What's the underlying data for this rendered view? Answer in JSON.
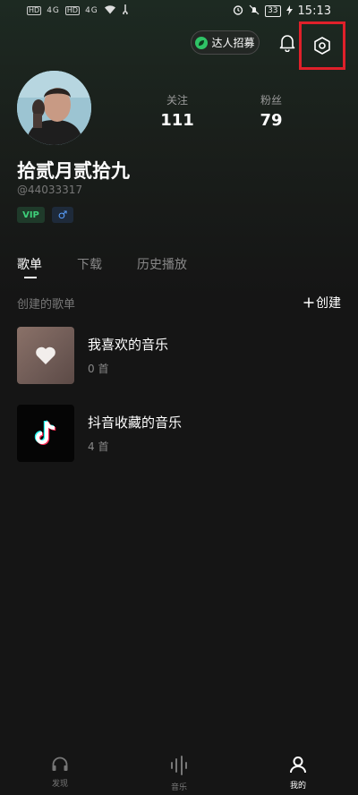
{
  "status_bar": {
    "hd1": "HD",
    "hd2": "HD",
    "sig1": "4G",
    "sig2": "4G",
    "battery": "33",
    "time": "15:13"
  },
  "header": {
    "recruit_label": "达人招募"
  },
  "profile": {
    "username": "拾贰月贰拾九",
    "user_id": "@44033317",
    "vip_badge": "VIP",
    "gender_symbol": "♂",
    "stats": {
      "follow_label": "关注",
      "follow_count": "111",
      "fans_label": "粉丝",
      "fans_count": "79"
    }
  },
  "tabs": [
    {
      "label": "歌单"
    },
    {
      "label": "下载"
    },
    {
      "label": "历史播放"
    }
  ],
  "playlists_section": {
    "title": "创建的歌单",
    "create_label": "创建",
    "items": [
      {
        "name": "我喜欢的音乐",
        "count": "0 首"
      },
      {
        "name": "抖音收藏的音乐",
        "count": "4 首"
      }
    ]
  },
  "bottom_nav": [
    {
      "label": "发现"
    },
    {
      "label": "音乐"
    },
    {
      "label": "我的"
    }
  ],
  "colors": {
    "background": "#151515",
    "highlight_box": "#e0202a",
    "vip_green": "#3ecf7a",
    "gender_blue": "#5aa0ff"
  }
}
